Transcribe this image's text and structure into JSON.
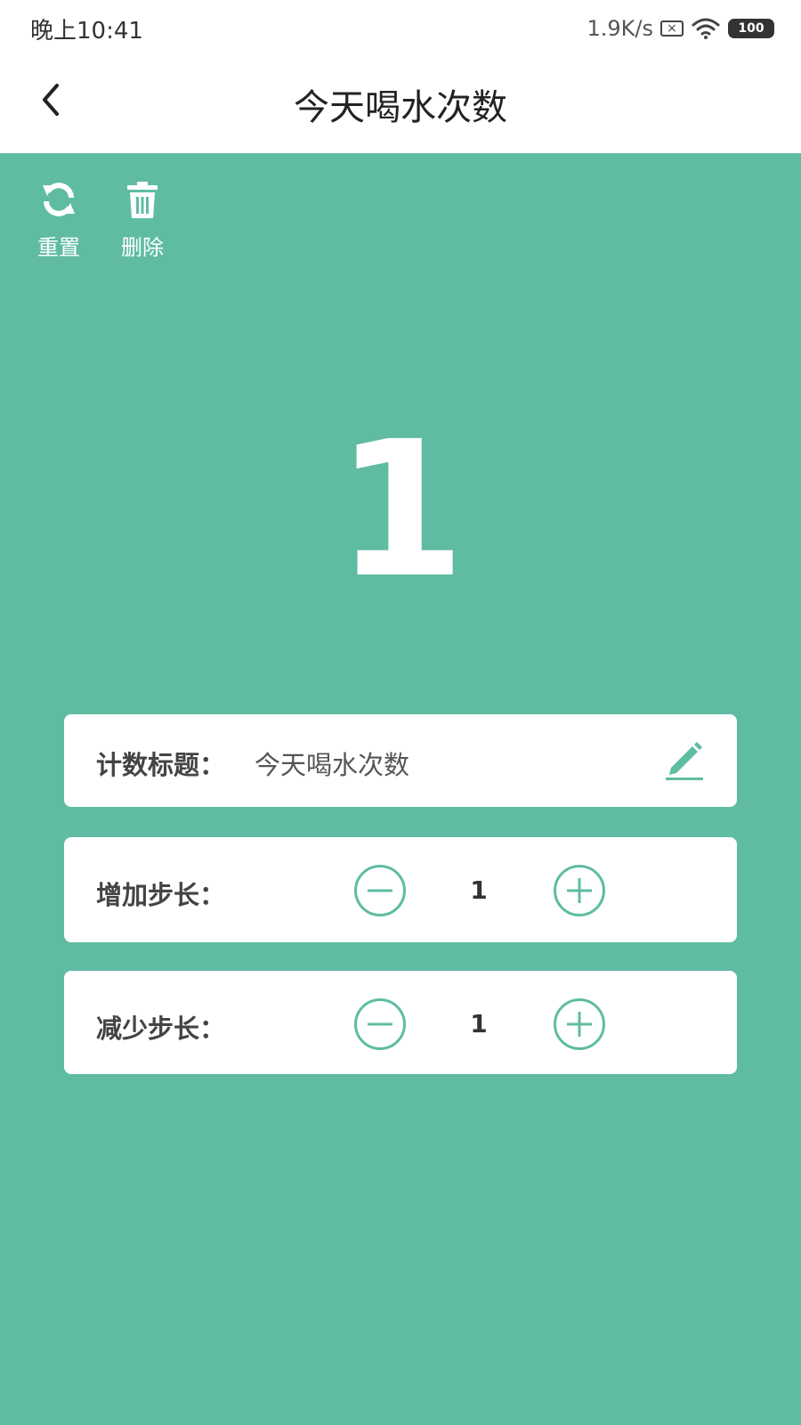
{
  "status_bar": {
    "time": "晚上10:41",
    "net_speed": "1.9K/s",
    "battery": "100"
  },
  "app_bar": {
    "title": "今天喝水次数"
  },
  "toolbar": {
    "reset_label": "重置",
    "delete_label": "删除"
  },
  "counter": {
    "value": "1"
  },
  "title_card": {
    "label": "计数标题：",
    "value": "今天喝水次数"
  },
  "increase_card": {
    "label": "增加步长：",
    "value": "1"
  },
  "decrease_card": {
    "label": "减少步长：",
    "value": "1"
  },
  "colors": {
    "background": "#5fbca3",
    "accent": "#5fbca3",
    "card": "#ffffff"
  }
}
